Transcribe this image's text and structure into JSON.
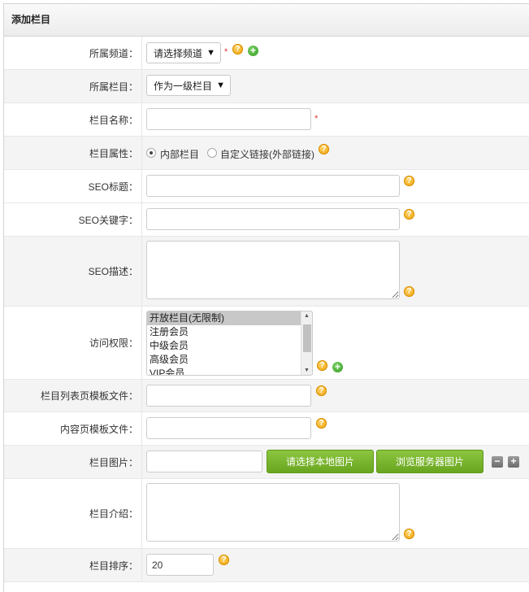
{
  "header": {
    "title": "添加栏目"
  },
  "rows": {
    "channel": {
      "label": "所属频道：",
      "select_value": "请选择频道",
      "required": "*"
    },
    "parent": {
      "label": "所属栏目：",
      "select_value": "作为一级栏目"
    },
    "name": {
      "label": "栏目名称：",
      "value": "",
      "required": "*"
    },
    "attribute": {
      "label": "栏目属性：",
      "option_internal": "内部栏目",
      "option_custom": "自定义链接(外部链接)",
      "selected": "内部栏目"
    },
    "seo_title": {
      "label": "SEO标题：",
      "value": ""
    },
    "seo_keywords": {
      "label": "SEO关键字：",
      "value": ""
    },
    "seo_desc": {
      "label": "SEO描述：",
      "value": ""
    },
    "access": {
      "label": "访问权限：",
      "options": [
        "开放栏目(无限制)",
        "注册会员",
        "中级会员",
        "高级会员",
        "VIP会员"
      ],
      "selected": "开放栏目(无限制)"
    },
    "list_template": {
      "label": "栏目列表页模板文件：",
      "value": ""
    },
    "content_template": {
      "label": "内容页模板文件：",
      "value": ""
    },
    "image": {
      "label": "栏目图片：",
      "value": "",
      "btn_local": "请选择本地图片",
      "btn_server": "浏览服务器图片"
    },
    "intro": {
      "label": "栏目介绍：",
      "value": ""
    },
    "sort": {
      "label": "栏目排序：",
      "value": "20"
    }
  },
  "icons": {
    "help": "question-mark-icon",
    "add": "plus-circle-icon",
    "minus": "minus-square-icon",
    "plus_sq": "plus-square-icon"
  },
  "colors": {
    "accent_green": "#7ab52f",
    "help_orange": "#f5a800",
    "required_red": "#d33"
  }
}
